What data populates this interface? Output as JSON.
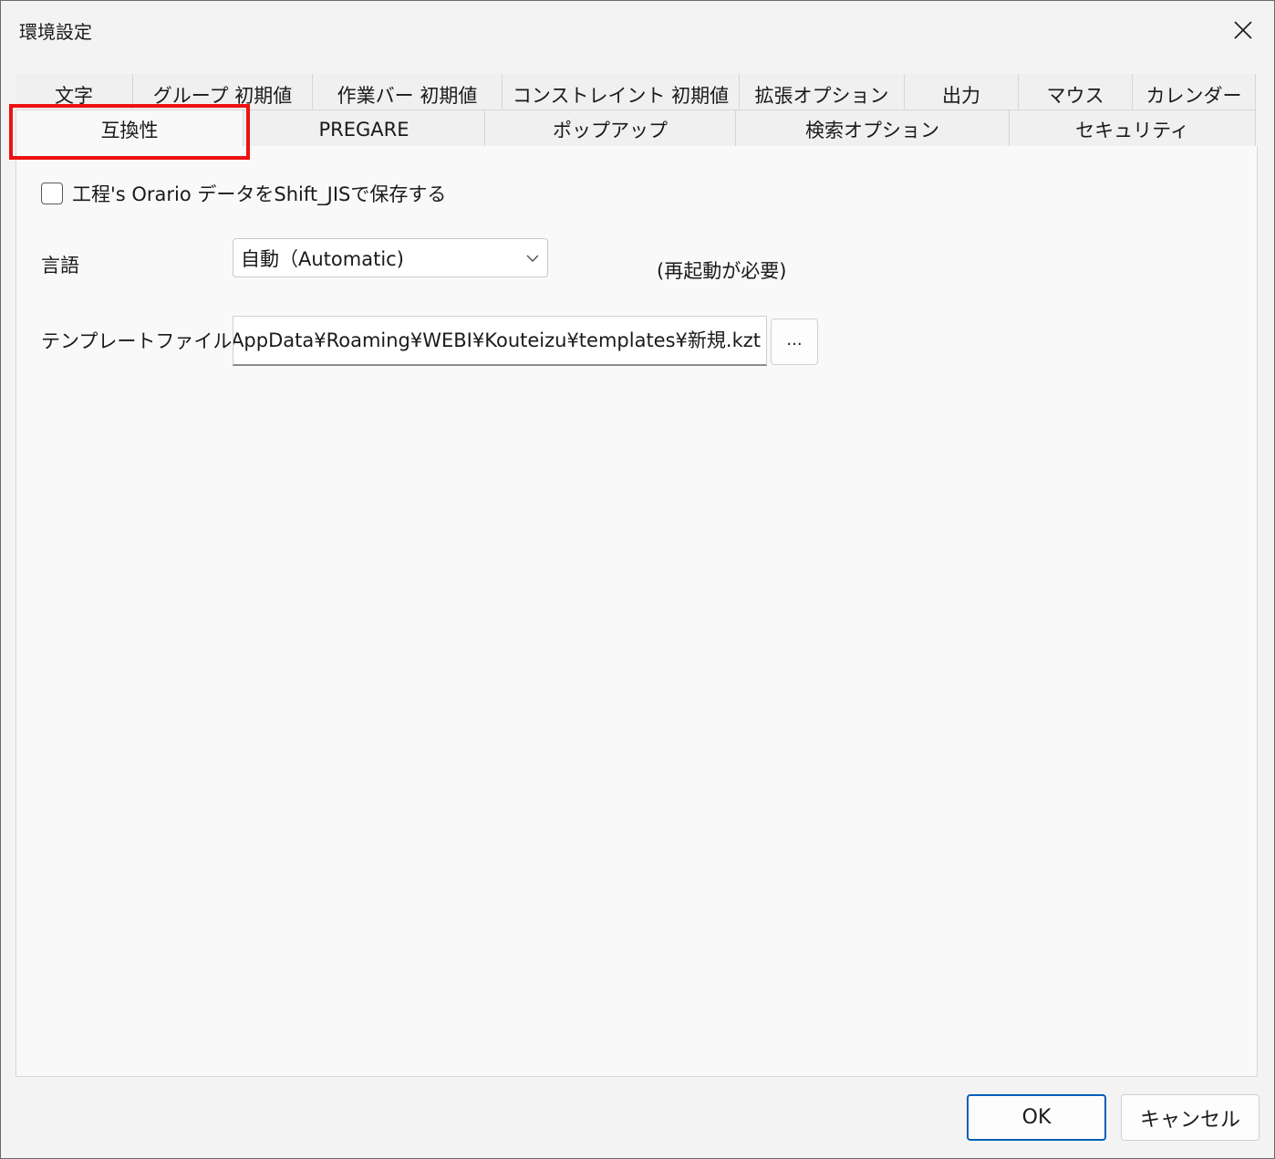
{
  "window": {
    "title": "環境設定"
  },
  "tabs": {
    "row1": [
      "文字",
      "グループ 初期値",
      "作業バー 初期値",
      "コンストレイント 初期値",
      "拡張オプション",
      "出力",
      "マウス",
      "カレンダー"
    ],
    "row2": [
      "互換性",
      "PREGARE",
      "ポップアップ",
      "検索オプション",
      "セキュリティ"
    ],
    "active": "互換性"
  },
  "compat": {
    "checkbox_label": "工程's Orario データをShift_JISで保存する",
    "checkbox_checked": false,
    "language_label": "言語",
    "language_value": "自動（Automatic)",
    "restart_note": "(再起動が必要)",
    "template_label": "テンプレートファイル",
    "template_value": "AppData¥Roaming¥WEBI¥Kouteizu¥templates¥新規.kzt",
    "browse_label": "..."
  },
  "footer": {
    "ok": "OK",
    "cancel": "キャンセル"
  },
  "colors": {
    "highlight": "#ee1111",
    "ok_border": "#005fb8",
    "background": "#f3f3f3"
  },
  "icons": {
    "close": "close-icon",
    "dropdown": "chevron-down-icon"
  }
}
